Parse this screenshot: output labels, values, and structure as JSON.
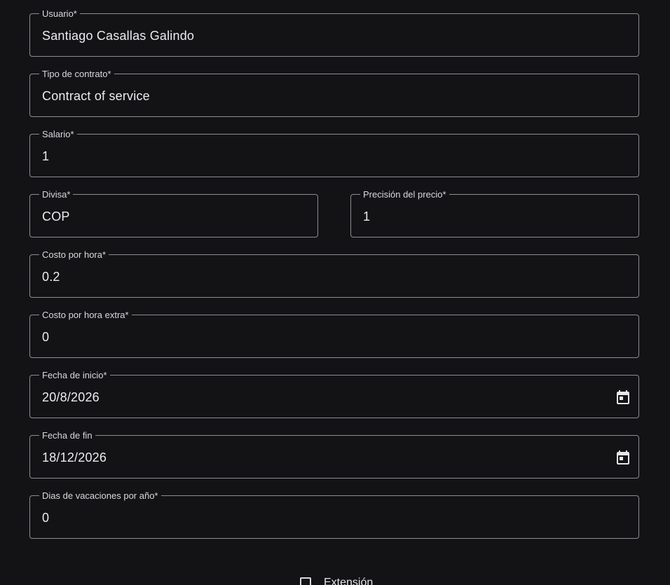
{
  "fields": {
    "usuario": {
      "label": "Usuario*",
      "value": "Santiago Casallas Galindo"
    },
    "tipo_contrato": {
      "label": "Tipo de contrato*",
      "value": "Contract of service"
    },
    "salario": {
      "label": "Salario*",
      "value": "1"
    },
    "divisa": {
      "label": "Divisa*",
      "value": "COP"
    },
    "precision_precio": {
      "label": "Precisión del precio*",
      "value": "1"
    },
    "costo_hora": {
      "label": "Costo por hora*",
      "value": "0.2"
    },
    "costo_hora_extra": {
      "label": "Costo por hora extra*",
      "value": "0"
    },
    "fecha_inicio": {
      "label": "Fecha de inicio*",
      "value": "20/8/2026",
      "icon": "calendar-icon"
    },
    "fecha_fin": {
      "label": "Fecha de fin",
      "value": "18/12/2026",
      "icon": "calendar-icon"
    },
    "dias_vacaciones": {
      "label": "Dias de vacaciones por año*",
      "value": "0"
    }
  },
  "extension": {
    "label": "Extensión",
    "checked": false
  },
  "colors": {
    "background": "#131316",
    "border": "#8c8c92",
    "text": "#ececf0"
  }
}
